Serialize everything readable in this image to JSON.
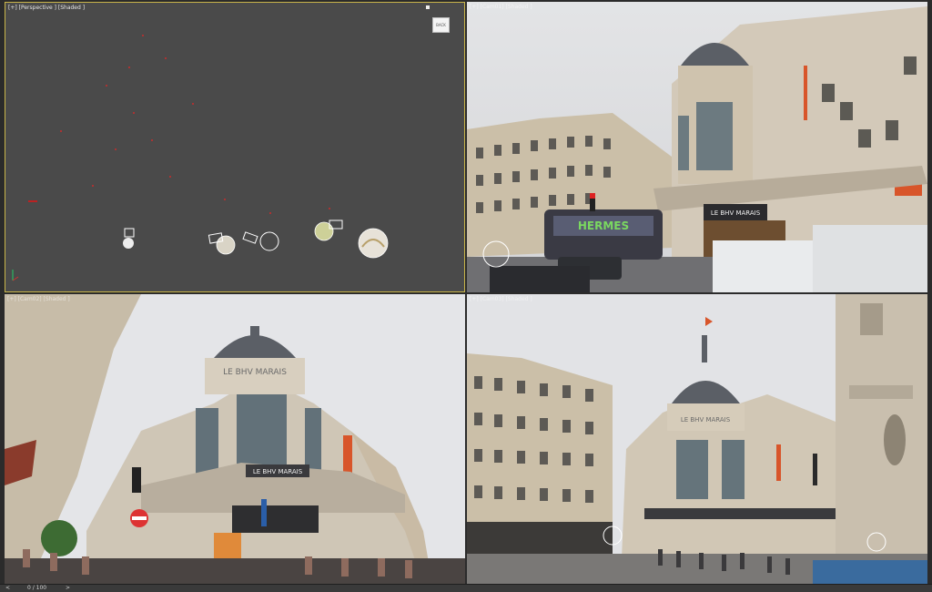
{
  "viewports": {
    "perspective": {
      "label": "[+] [Perspective ] [Shaded ]",
      "viewcube_text": "BACK"
    },
    "top_right": {
      "label": "[+] [Cam01] [Shaded ]"
    },
    "bottom_left": {
      "label": "[+] [Cam02] [Shaded ]"
    },
    "bottom_right": {
      "label": "[+] [Cam03] [Shaded ]"
    }
  },
  "signs": {
    "storefront": "LE BHV MARAIS",
    "dome": "LE BHV MARAIS",
    "bus_graffiti": "HERMES"
  },
  "timeline": {
    "frame": "0 / 100",
    "left_arrow": "<",
    "right_arrow": ">"
  },
  "colors": {
    "active_border": "#c9b54a",
    "viewport_bg": "#4a4a4a",
    "sky": "#dcdde0",
    "facade": "#cfc6b6",
    "dome": "#5b5f66"
  }
}
